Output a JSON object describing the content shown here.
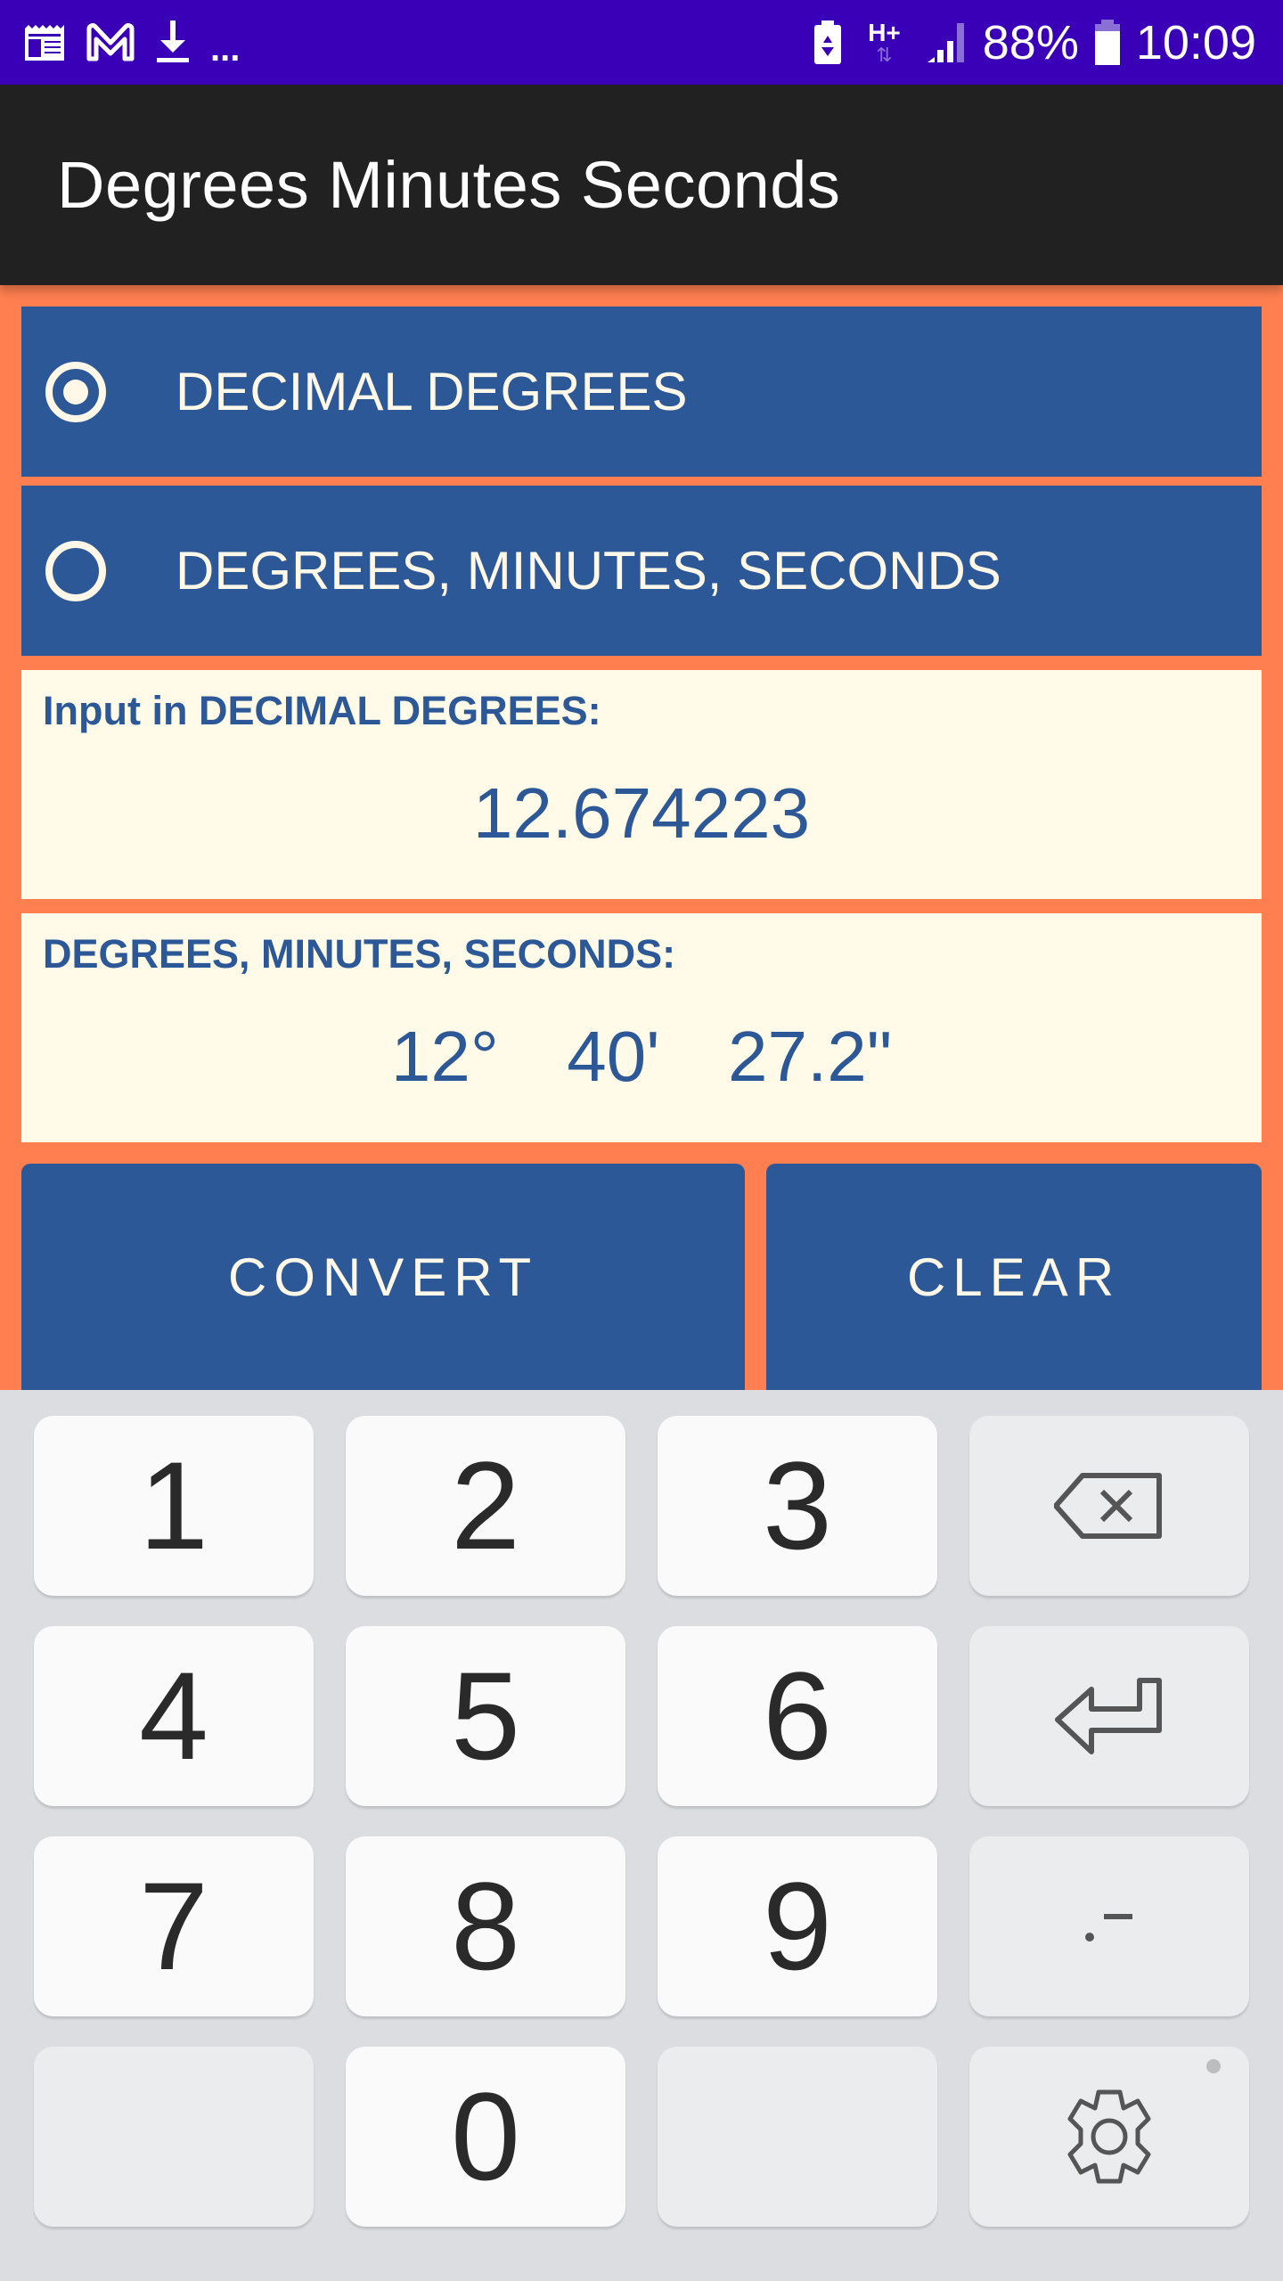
{
  "status_bar": {
    "left_icons": [
      "news-icon",
      "gmail-icon",
      "download-icon",
      "more-notifications-icon"
    ],
    "more_label": "...",
    "right_icons": [
      "battery-saver-icon",
      "network-hplus-icon",
      "signal-icon",
      "battery-icon"
    ],
    "network_type": "H+",
    "battery_percent": "88%",
    "time": "10:09"
  },
  "app_bar": {
    "title": "Degrees Minutes Seconds"
  },
  "mode_selector": {
    "options": [
      {
        "label": "DECIMAL DEGREES",
        "checked": true
      },
      {
        "label": "DEGREES, MINUTES, SECONDS",
        "checked": false
      }
    ]
  },
  "input_card": {
    "label": "Input in DECIMAL DEGREES:",
    "value": "12.674223"
  },
  "output_card": {
    "label": "DEGREES, MINUTES, SECONDS:",
    "degrees": "12°",
    "minutes": "40'",
    "seconds": "27.2\""
  },
  "actions": {
    "convert_label": "CONVERT",
    "clear_label": "CLEAR"
  },
  "keyboard": {
    "keys": [
      "1",
      "2",
      "3",
      "backspace",
      "4",
      "5",
      "6",
      "enter",
      "7",
      "8",
      "9",
      ".-",
      "",
      "0",
      "",
      "settings"
    ],
    "dot_dash_label": ".-"
  },
  "colors": {
    "status_bar": "#3a00b8",
    "app_bar": "#212121",
    "background": "#FF7F50",
    "primary": "#2d5897",
    "card": "#fffbe8",
    "on_primary": "#fff8e8"
  }
}
